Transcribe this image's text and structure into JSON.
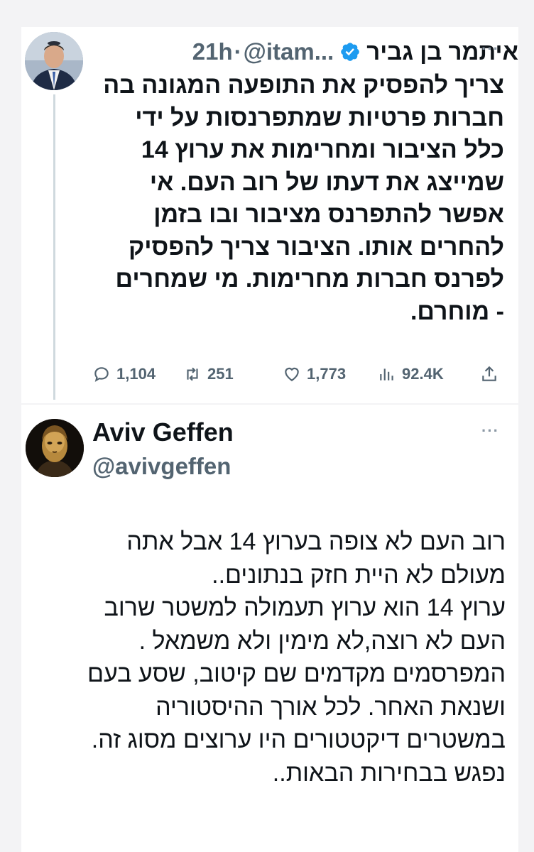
{
  "tweet1": {
    "author_name": "איתמר בן גביר",
    "handle": "@itam...",
    "separator": "·",
    "time": "21h",
    "more": "···",
    "text_lines": [
      "צריך להפסיק את התופעה המגונה בה",
      "חברות פרטיות שמתפרנסות על ידי",
      "כלל הציבור ומחרימות את ערוץ 14",
      "שמייצג את דעתו של רוב העם. אי",
      "אפשר להתפרנס מציבור ובו בזמן",
      "להחרים אותו. הציבור צריך להפסיק",
      "לפרנס חברות מחרימות. מי שמחרים",
      "- מוחרם."
    ],
    "replies": "1,104",
    "retweets": "251",
    "likes": "1,773",
    "views": "92.4K",
    "icons": [
      "reply-icon",
      "retweet-icon",
      "like-icon",
      "views-icon",
      "share-icon",
      "verified-icon"
    ],
    "colors": {
      "verified": "#1d9bf0",
      "muted": "#536471"
    }
  },
  "tweet2": {
    "author_name": "Aviv Geffen",
    "handle": "@avivgeffen",
    "more": "···",
    "text_lines": [
      "רוב העם לא צופה בערוץ 14 אבל אתה",
      "מעולם לא היית חזק בנתונים..",
      "ערוץ 14 הוא ערוץ תעמולה למשטר שרוב",
      "העם לא רוצה,לא מימין ולא משמאל .",
      "המפרסמים מקדמים שם קיטוב, שסע בעם",
      "ושנאת האחר. לכל אורך ההיסטוריה",
      "במשטרים דיקטטורים היו ערוצים מסוג זה.",
      "נפגש בבחירות הבאות.."
    ]
  }
}
